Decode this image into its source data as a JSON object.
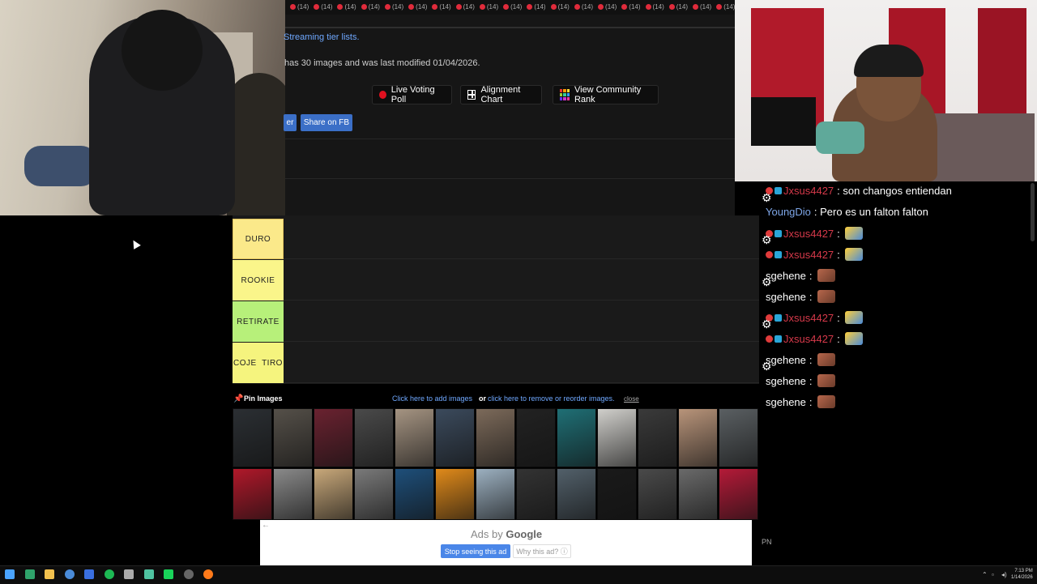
{
  "site": {
    "top_strip_count": "(14)",
    "streaming_link": "Streaming tier lists.",
    "images_info": "has 30 images and was last modified 01/04/2026.",
    "buttons": {
      "live_voting": "Live Voting Poll",
      "alignment": "Alignment Chart",
      "community_rank": "View Community Rank"
    },
    "share": {
      "twitter": "er",
      "facebook": "Share on FB"
    }
  },
  "tiers": [
    {
      "label": "DURO",
      "color": "#fbe98a"
    },
    {
      "label": "ROOKIE",
      "color": "#faf58a"
    },
    {
      "label": "RETIRATE",
      "color": "#b7f07a"
    },
    {
      "label": "COJE  TIRO",
      "color": "#f5f47e"
    }
  ],
  "pin_bar": {
    "pin_label": "Pin Images",
    "add_link": "Click here to add images",
    "or_text": "or",
    "reorder_link": "click here to remove or reorder images.",
    "close": "close"
  },
  "ad": {
    "back_arrow": "←",
    "ads_by": "Ads by",
    "google": "Google",
    "stop": "Stop seeing this ad",
    "why": "Why this ad? ⓘ"
  },
  "pn_label": "PN",
  "chat": [
    {
      "user": "Jxsus4427",
      "color": "#d6394a",
      "badges": true,
      "text": ": son changos entiendan",
      "emote": null
    },
    {
      "user": "YoungDio",
      "color": "#7fa7e8",
      "badges": false,
      "text": ": Pero es un falton falton",
      "emote": null
    },
    {
      "user": "Jxsus4427",
      "color": "#d6394a",
      "badges": true,
      "text": ":",
      "emote": "cat"
    },
    {
      "user": "Jxsus4427",
      "color": "#d6394a",
      "badges": true,
      "text": ":",
      "emote": "cat"
    },
    {
      "user": "sgehene",
      "color": "#ffffff",
      "badges": false,
      "text": ":",
      "emote": "face"
    },
    {
      "user": "sgehene",
      "color": "#ffffff",
      "badges": false,
      "text": ":",
      "emote": "face"
    },
    {
      "user": "Jxsus4427",
      "color": "#d6394a",
      "badges": true,
      "text": ":",
      "emote": "cat"
    },
    {
      "user": "Jxsus4427",
      "color": "#d6394a",
      "badges": true,
      "text": ":",
      "emote": "cat"
    },
    {
      "user": "sgehene",
      "color": "#ffffff",
      "badges": false,
      "text": ":",
      "emote": "face"
    },
    {
      "user": "sgehene",
      "color": "#ffffff",
      "badges": false,
      "text": ":",
      "emote": "face"
    },
    {
      "user": "sgehene",
      "color": "#ffffff",
      "badges": false,
      "text": ":",
      "emote": "face"
    }
  ],
  "taskbar": {
    "time": "7:13 PM",
    "date": "1/14/2026",
    "icons": [
      "windows-icon",
      "terminal-icon",
      "file-explorer-icon",
      "chrome-icon",
      "app-blue-icon",
      "spotify-icon",
      "pen-icon",
      "terminal2-icon",
      "green-app-icon",
      "obs-icon",
      "firefox-icon"
    ]
  },
  "colors": {
    "link_blue": "#6fa8ff",
    "share_blue": "#3b6fc7",
    "live_red": "#e0101f"
  }
}
